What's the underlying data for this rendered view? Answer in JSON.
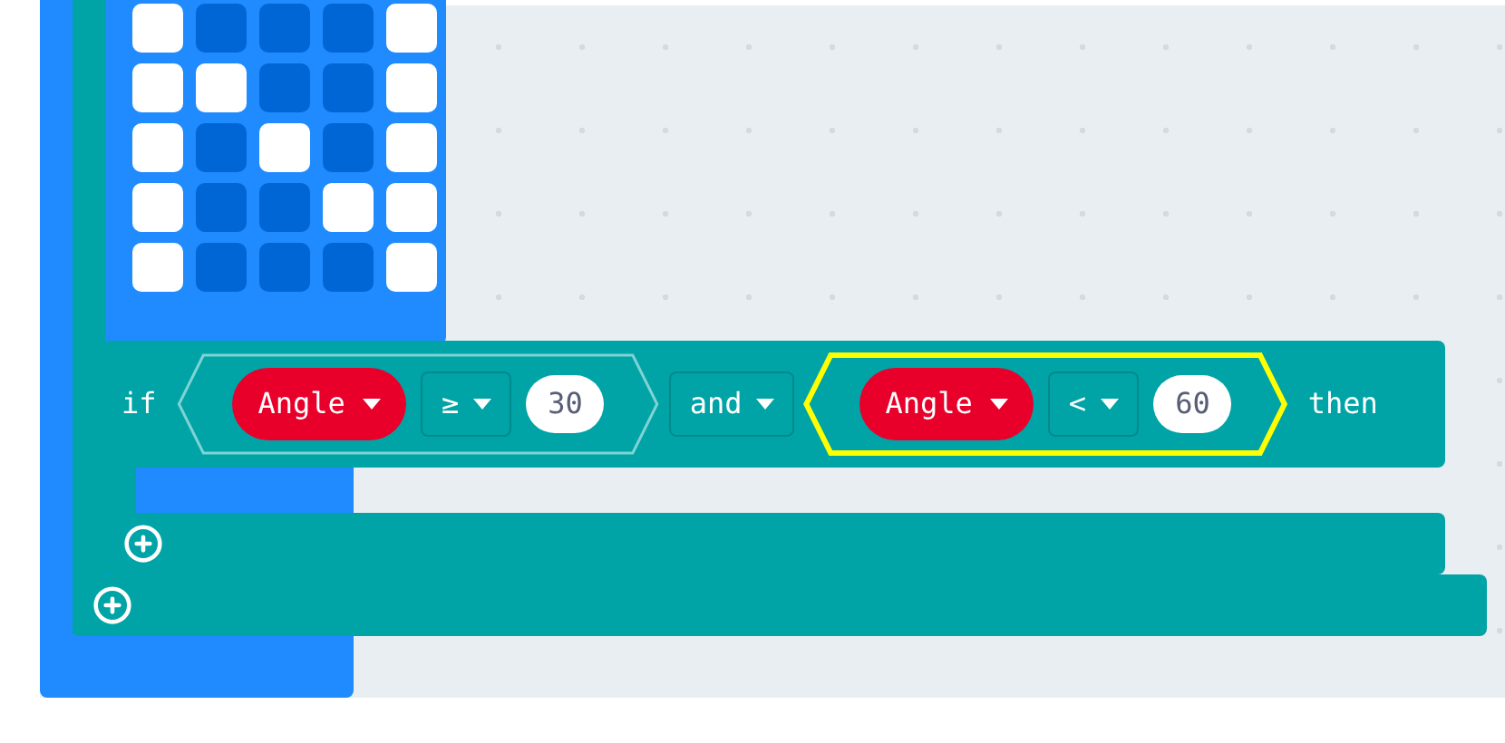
{
  "led_grid": [
    {
      "cells": [
        {
          "on": true
        },
        {
          "on": false
        },
        {
          "on": false
        },
        {
          "on": false
        },
        {
          "on": true
        }
      ]
    },
    {
      "cells": [
        {
          "on": true
        },
        {
          "on": true
        },
        {
          "on": false
        },
        {
          "on": false
        },
        {
          "on": true
        }
      ]
    },
    {
      "cells": [
        {
          "on": true
        },
        {
          "on": false
        },
        {
          "on": true
        },
        {
          "on": false
        },
        {
          "on": true
        }
      ]
    },
    {
      "cells": [
        {
          "on": true
        },
        {
          "on": false
        },
        {
          "on": false
        },
        {
          "on": true
        },
        {
          "on": true
        }
      ]
    },
    {
      "cells": [
        {
          "on": true
        },
        {
          "on": false
        },
        {
          "on": false
        },
        {
          "on": false
        },
        {
          "on": true
        }
      ]
    }
  ],
  "if_block": {
    "keyword": "if",
    "conjunction": "and",
    "then": "then",
    "comparisons": [
      {
        "variable": "Angle",
        "operator": "≥",
        "value": "30",
        "selected": false
      },
      {
        "variable": "Angle",
        "operator": "<",
        "value": "60",
        "selected": true
      }
    ]
  }
}
